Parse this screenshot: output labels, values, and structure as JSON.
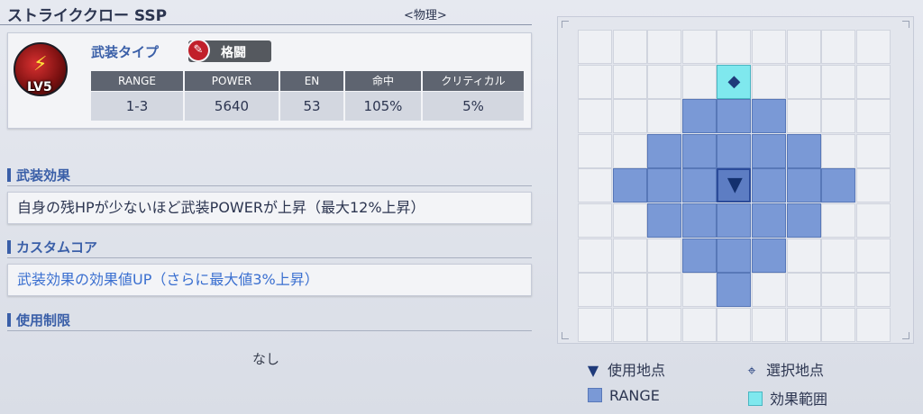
{
  "header": {
    "weapon_name": "ストライククロー SSP",
    "attribute": "<物理>"
  },
  "weapon": {
    "badge_level": "LV5",
    "type_label": "武装タイプ",
    "type_value": "格闘",
    "stats": [
      {
        "label": "RANGE",
        "value": "1-3"
      },
      {
        "label": "POWER",
        "value": "5640"
      },
      {
        "label": "EN",
        "value": "53"
      },
      {
        "label": "命中",
        "value": "105%"
      },
      {
        "label": "クリティカル",
        "value": "5%"
      }
    ]
  },
  "sections": {
    "effect_title": "武装効果",
    "effect_text": "自身の残HPが少ないほど武装POWERが上昇（最大12%上昇）",
    "core_title": "カスタムコア",
    "core_text": "武装効果の効果値UP（さらに最大値3%上昇）",
    "restriction_title": "使用制限",
    "restriction_text": "なし"
  },
  "legend": {
    "use_point": "使用地点",
    "select_point": "選択地点",
    "range": "RANGE",
    "effect_area": "効果範囲"
  },
  "colors": {
    "accent": "#3a5fa8",
    "range": "#7a99d6",
    "effect": "#7fe8ee",
    "core_text": "#3a6fd0"
  }
}
